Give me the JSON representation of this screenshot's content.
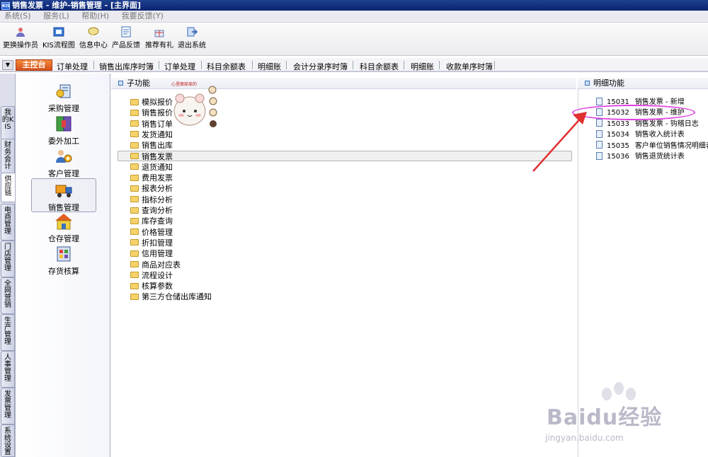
{
  "window": {
    "logo_text": "KIS",
    "title": "销售发票 - 维护-销售管理 - [主界面]"
  },
  "menu": [
    "系统(S)",
    "服务(L)",
    "帮助(H)",
    "我要反馈(Y)"
  ],
  "toolbar": [
    {
      "label": "更换操作员",
      "icon": "user-switch-icon"
    },
    {
      "label": "KIS流程图",
      "icon": "flowchart-icon"
    },
    {
      "label": "信息中心",
      "icon": "chat-bubble-icon"
    },
    {
      "label": "产品反馈",
      "icon": "feedback-icon"
    },
    {
      "label": "推荐有礼",
      "icon": "gift-icon"
    },
    {
      "label": "退出系统",
      "icon": "exit-icon"
    }
  ],
  "tabs": {
    "main": "主控台",
    "items": [
      "订单处理",
      "销售出库序时簿",
      "订单处理",
      "科目余额表",
      "明细账",
      "会计分录序时簿",
      "科目余额表",
      "明细账",
      "收款单序时簿"
    ]
  },
  "vtabs": [
    "我的KIS",
    "财务会计",
    "供应链",
    "电商管理",
    "门店管理",
    "全网营销",
    "生产管理",
    "人事管理",
    "发票管理",
    "系统设置"
  ],
  "modules": [
    {
      "label": "采购管理",
      "icon": "purchase-icon"
    },
    {
      "label": "委外加工",
      "icon": "outsourcing-icon"
    },
    {
      "label": "客户管理",
      "icon": "customer-icon"
    },
    {
      "label": "销售管理",
      "icon": "sales-truck-icon"
    },
    {
      "label": "仓存管理",
      "icon": "warehouse-icon"
    },
    {
      "label": "存货核算",
      "icon": "inventory-icon"
    }
  ],
  "sub_panel": {
    "title": "子功能",
    "folders": [
      "模拟报价",
      "销售报价",
      "销售订单",
      "发货通知",
      "销售出库",
      "销售发票",
      "退货通知",
      "费用发票",
      "报表分析",
      "指标分析",
      "查询分析",
      "库存查询",
      "价格管理",
      "折扣管理",
      "信用管理",
      "商品对应表",
      "流程设计",
      "核算参数",
      "第三方仓储出库通知"
    ],
    "visible_labels": [
      "模拟报价",
      "销售报价",
      "销售订单"
    ],
    "sticker_caption": "心里面痒痒的"
  },
  "detail_panel": {
    "title": "明细功能",
    "items": [
      {
        "code": "15031",
        "label": "销售发票 - 新增"
      },
      {
        "code": "15032",
        "label": "销售发票 - 维护"
      },
      {
        "code": "15033",
        "label": "销售发票 - 钩稽日志"
      },
      {
        "code": "15034",
        "label": "销售收入统计表"
      },
      {
        "code": "15035",
        "label": "客户单位销售情况明细表"
      },
      {
        "code": "15036",
        "label": "销售退货统计表"
      }
    ]
  },
  "watermark": {
    "brand": "Baidu经验",
    "url": "jingyan.baidu.com"
  },
  "colors": {
    "title_bar": "#0a2470",
    "main_tab": "#e06020",
    "highlight": "#e040e0",
    "arrow": "#e03030"
  }
}
